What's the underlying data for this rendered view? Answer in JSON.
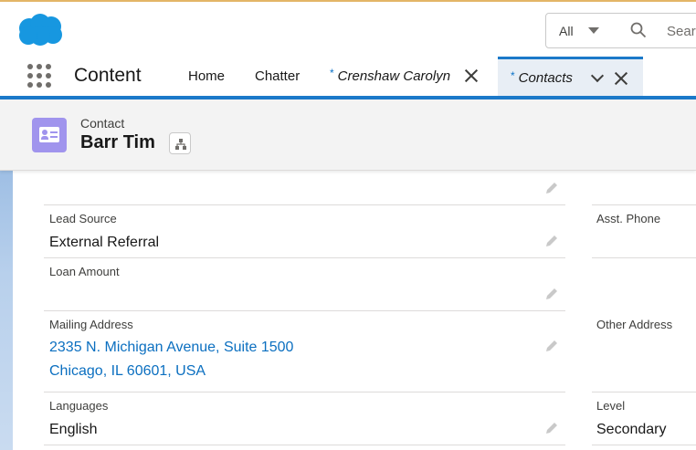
{
  "header": {
    "search_scope": "All",
    "search_placeholder": "Sear"
  },
  "nav": {
    "app_name": "Content",
    "tabs": [
      {
        "label": "Home"
      },
      {
        "label": "Chatter"
      },
      {
        "label": "Crenshaw Carolyn",
        "marker": "*"
      },
      {
        "label": "Contacts",
        "marker": "*"
      }
    ]
  },
  "record": {
    "type": "Contact",
    "name": "Barr Tim"
  },
  "fields": {
    "lead_source": {
      "label": "Lead Source",
      "value": "External Referral"
    },
    "asst_phone": {
      "label": "Asst. Phone",
      "value": ""
    },
    "loan_amount": {
      "label": "Loan Amount",
      "value": ""
    },
    "mailing_address": {
      "label": "Mailing Address",
      "line1": "2335 N. Michigan Avenue, Suite 1500",
      "line2": "Chicago, IL 60601, USA"
    },
    "other_address": {
      "label": "Other Address",
      "value": ""
    },
    "languages": {
      "label": "Languages",
      "value": "English"
    },
    "level": {
      "label": "Level",
      "value": "Secondary"
    }
  },
  "colors": {
    "brand_blue": "#1b79c9",
    "link": "#0b6fc0",
    "contact_icon": "#a094ed",
    "logo": "#1797e0"
  }
}
